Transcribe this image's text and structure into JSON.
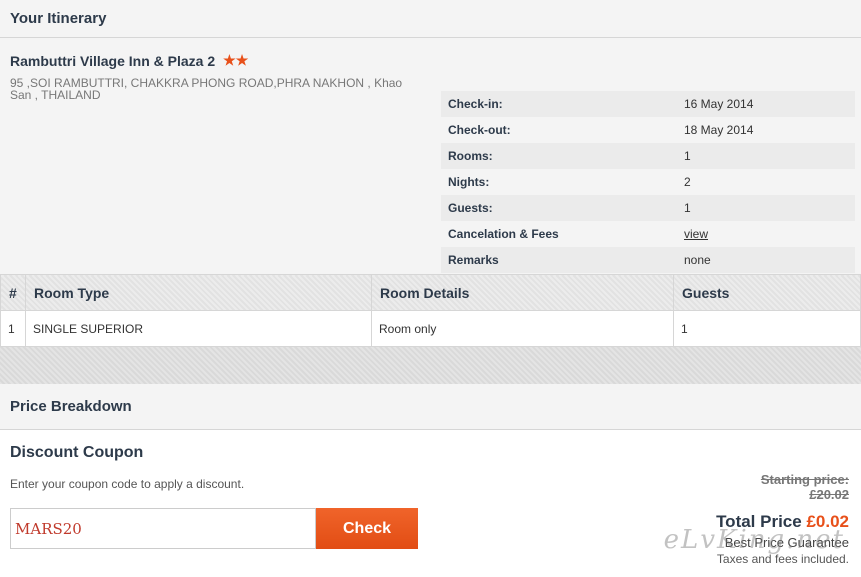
{
  "itinerary": {
    "title": "Your Itinerary",
    "hotel_name": "Rambuttri Village Inn & Plaza 2",
    "stars": "★★",
    "address": "95 ,SOI RAMBUTTRI, CHAKKRA PHONG ROAD,PHRA NAKHON , Khao San , THAILAND",
    "details": [
      {
        "label": "Check-in:",
        "value": "16 May 2014"
      },
      {
        "label": "Check-out:",
        "value": "18 May 2014"
      },
      {
        "label": "Rooms:",
        "value": "1"
      },
      {
        "label": "Nights:",
        "value": "2"
      },
      {
        "label": "Guests:",
        "value": "1"
      },
      {
        "label": "Cancelation & Fees",
        "value": "view"
      },
      {
        "label": "Remarks",
        "value": "none"
      }
    ]
  },
  "room_table": {
    "headers": [
      "#",
      "Room Type",
      "Room Details",
      "Guests"
    ],
    "rows": [
      [
        "1",
        "SINGLE SUPERIOR",
        "Room only",
        "1"
      ]
    ]
  },
  "price": {
    "title": "Price Breakdown",
    "coupon_title": "Discount Coupon",
    "coupon_hint": "Enter your coupon code to apply a discount.",
    "coupon_value": "MARS20",
    "check_label": "Check",
    "starting_label": "Starting price:",
    "starting_value": "£20.02",
    "total_label": "Total Price",
    "total_value": "£0.02",
    "guarantee": "Best Price Guarantee",
    "taxes": "Taxes and fees included."
  },
  "watermark": "eLvKing.net",
  "colors": {
    "accent": "#e8501a",
    "heading": "#2d3a4a"
  }
}
